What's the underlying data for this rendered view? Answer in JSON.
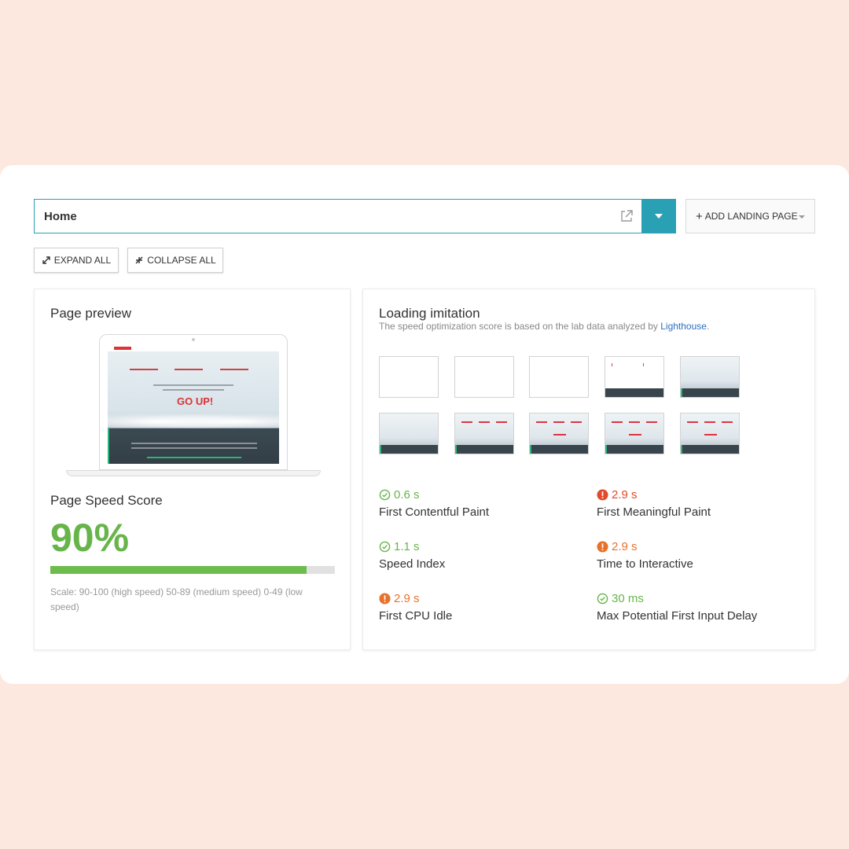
{
  "page_select": {
    "value": "Home"
  },
  "buttons": {
    "add_landing_page": "ADD LANDING PAGE",
    "expand_all": "EXPAND ALL",
    "collapse_all": "COLLAPSE ALL"
  },
  "preview_panel": {
    "title": "Page preview",
    "screen_text": "GO UP!",
    "score_title": "Page Speed Score",
    "score": "90%",
    "score_fraction": 0.9,
    "scale": "Scale: 90-100 (high speed) 50-89 (medium speed) 0-49 (low speed)"
  },
  "loading_panel": {
    "title": "Loading imitation",
    "subtitle": "The speed optimization score is based on the lab data analyzed by",
    "link": "Lighthouse",
    "link_suffix": "."
  },
  "metrics": [
    {
      "value": "0.6 s",
      "label": "First Contentful Paint",
      "status": "good"
    },
    {
      "value": "2.9 s",
      "label": "First Meaningful Paint",
      "status": "bad"
    },
    {
      "value": "1.1 s",
      "label": "Speed Index",
      "status": "good"
    },
    {
      "value": "2.9 s",
      "label": "Time to Interactive",
      "status": "warn"
    },
    {
      "value": "2.9 s",
      "label": "First CPU Idle",
      "status": "warn"
    },
    {
      "value": "30 ms",
      "label": "Max Potential First Input Delay",
      "status": "good"
    }
  ],
  "colors": {
    "accent": "#2aa0b5",
    "good": "#67b54a",
    "bad": "#e24a2b",
    "warn": "#e8712a",
    "link": "#2b6fbf"
  },
  "icons": {
    "external": "external-link-icon",
    "good": "check-circle-icon",
    "bad": "alert-circle-icon"
  }
}
